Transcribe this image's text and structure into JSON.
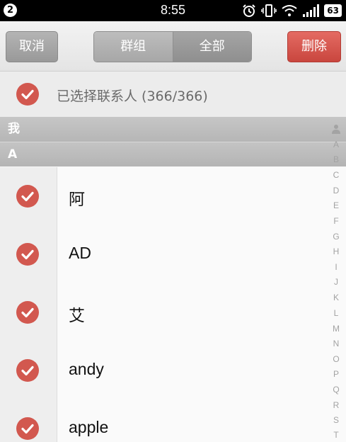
{
  "status_bar": {
    "notification_count": "2",
    "time": "8:55",
    "battery": "63",
    "icons": [
      "alarm-icon",
      "vibrate-icon",
      "wifi-icon",
      "signal-icon",
      "battery-icon"
    ]
  },
  "toolbar": {
    "cancel_label": "取消",
    "tabs": [
      {
        "label": "群组",
        "active": false
      },
      {
        "label": "全部",
        "active": true
      }
    ],
    "delete_label": "删除"
  },
  "selection": {
    "label": "已选择联系人 (366/366)",
    "checked": true
  },
  "sections": {
    "me": "我",
    "a": "A"
  },
  "contacts": [
    {
      "name": "阿",
      "checked": true
    },
    {
      "name": "AD",
      "checked": true
    },
    {
      "name": "艾",
      "checked": true
    },
    {
      "name": "andy",
      "checked": true
    },
    {
      "name": "apple",
      "checked": true
    }
  ],
  "index": [
    "A",
    "B",
    "C",
    "D",
    "E",
    "F",
    "G",
    "H",
    "I",
    "J",
    "K",
    "L",
    "M",
    "N",
    "O",
    "P",
    "Q",
    "R",
    "S",
    "T"
  ],
  "colors": {
    "check_red": "#d2584f",
    "delete_red": "#d9564e",
    "header_gray": "#bdbdbd"
  }
}
